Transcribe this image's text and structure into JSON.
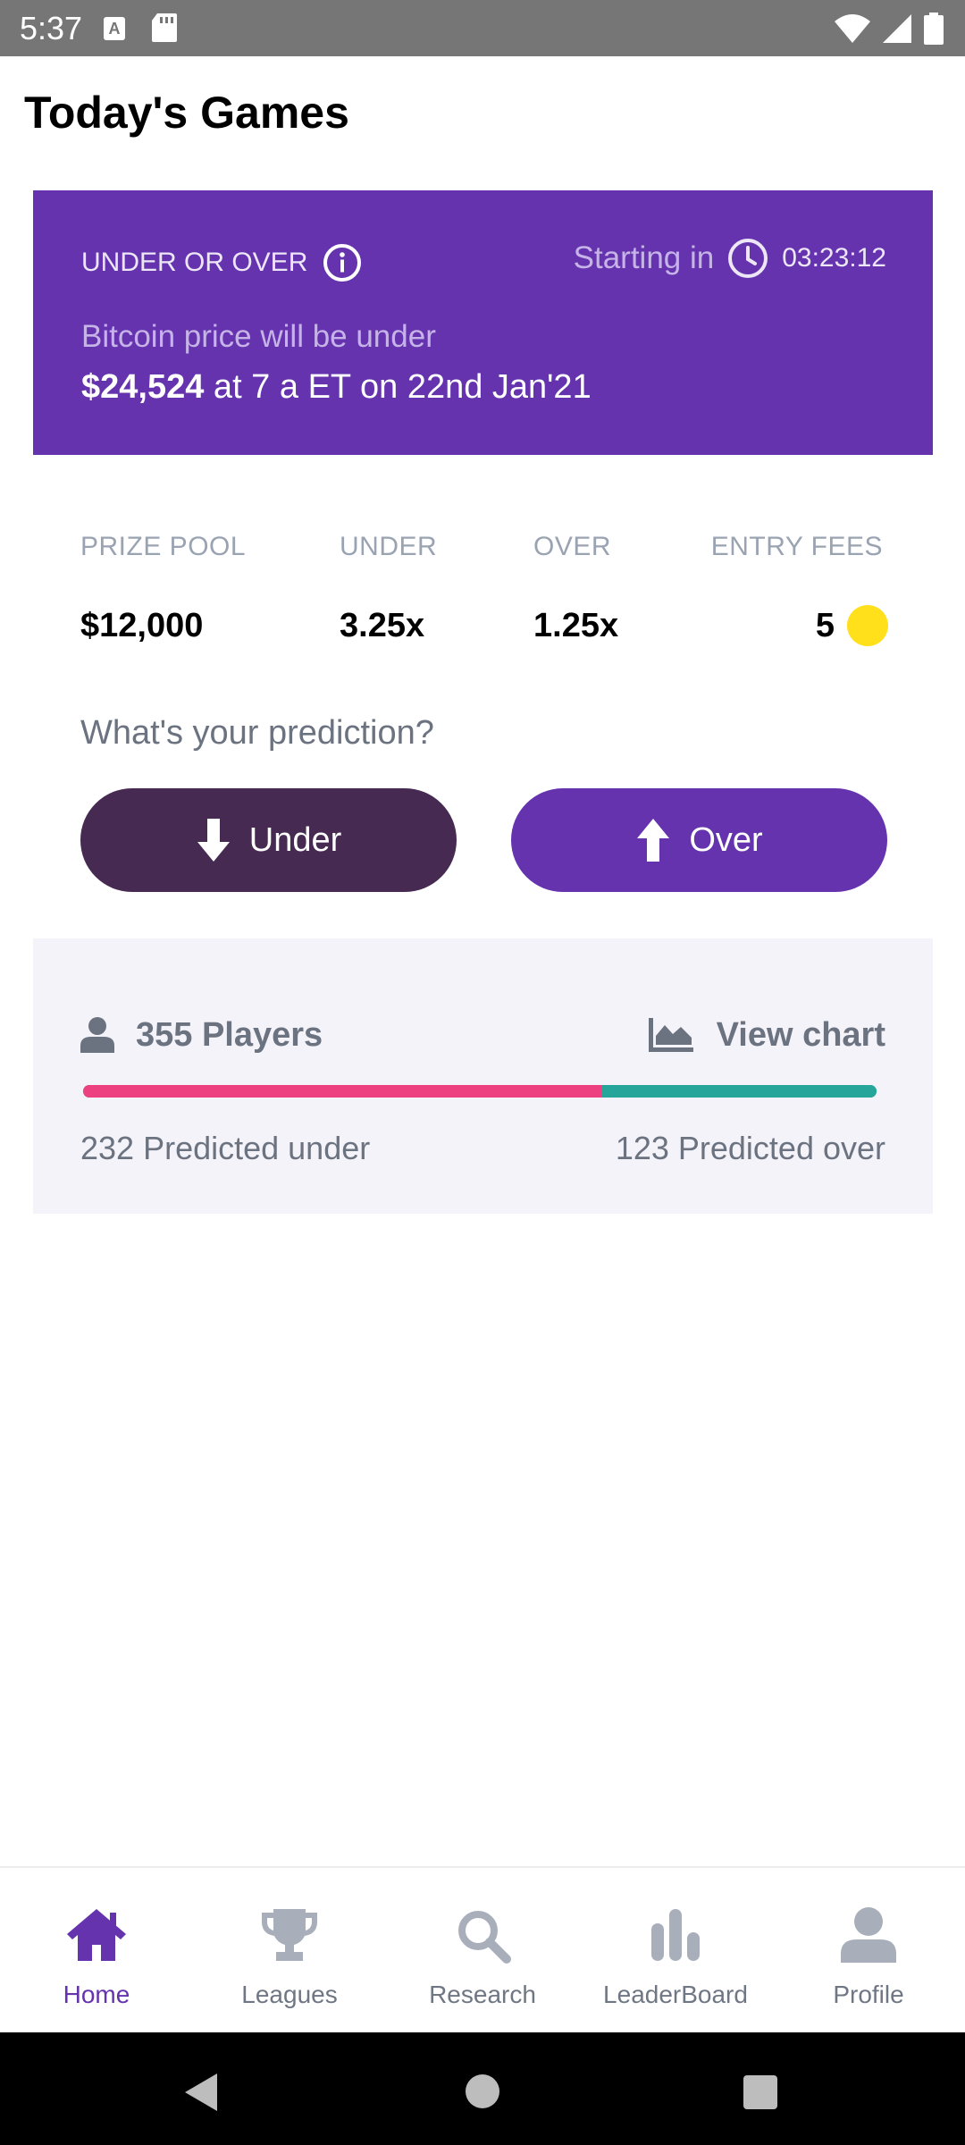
{
  "status_bar": {
    "time": "5:37",
    "icons": [
      "a-notification-icon",
      "sd-card-icon",
      "wifi-icon",
      "signal-icon",
      "battery-icon"
    ]
  },
  "header": {
    "title": "Today's Games"
  },
  "game_card": {
    "type_label": "UNDER OR OVER",
    "starting_label": "Starting in",
    "countdown": "03:23:12",
    "question_line1": "Bitcoin price will be under",
    "price": "$24,524",
    "question_suffix": " at 7 a ET on 22nd Jan'21",
    "background": "#6533AE"
  },
  "stats": {
    "prize_pool_label": "PRIZE POOL",
    "prize_pool_value": "$12,000",
    "under_label": "UNDER",
    "under_value": "3.25x",
    "over_label": "OVER",
    "over_value": "1.25x",
    "entry_fees_label": "ENTRY FEES",
    "entry_fees_value": "5"
  },
  "prediction": {
    "prompt": "What's your prediction?",
    "under_button": "Under",
    "over_button": "Over"
  },
  "players": {
    "count_label": "355 Players",
    "view_chart": "View chart",
    "under_text": "232 Predicted under",
    "over_text": "123 Predicted over",
    "under_count": 232,
    "over_count": 123,
    "under_color": "#EC4080",
    "over_color": "#26A69A"
  },
  "bottom_nav": {
    "items": [
      {
        "label": "Home",
        "icon": "home-icon",
        "active": true
      },
      {
        "label": "Leagues",
        "icon": "trophy-icon",
        "active": false
      },
      {
        "label": "Research",
        "icon": "search-icon",
        "active": false
      },
      {
        "label": "LeaderBoard",
        "icon": "bar-chart-icon",
        "active": false
      },
      {
        "label": "Profile",
        "icon": "person-icon",
        "active": false
      }
    ],
    "active_color": "#6533AE",
    "inactive_color": "#A8AFBA"
  }
}
